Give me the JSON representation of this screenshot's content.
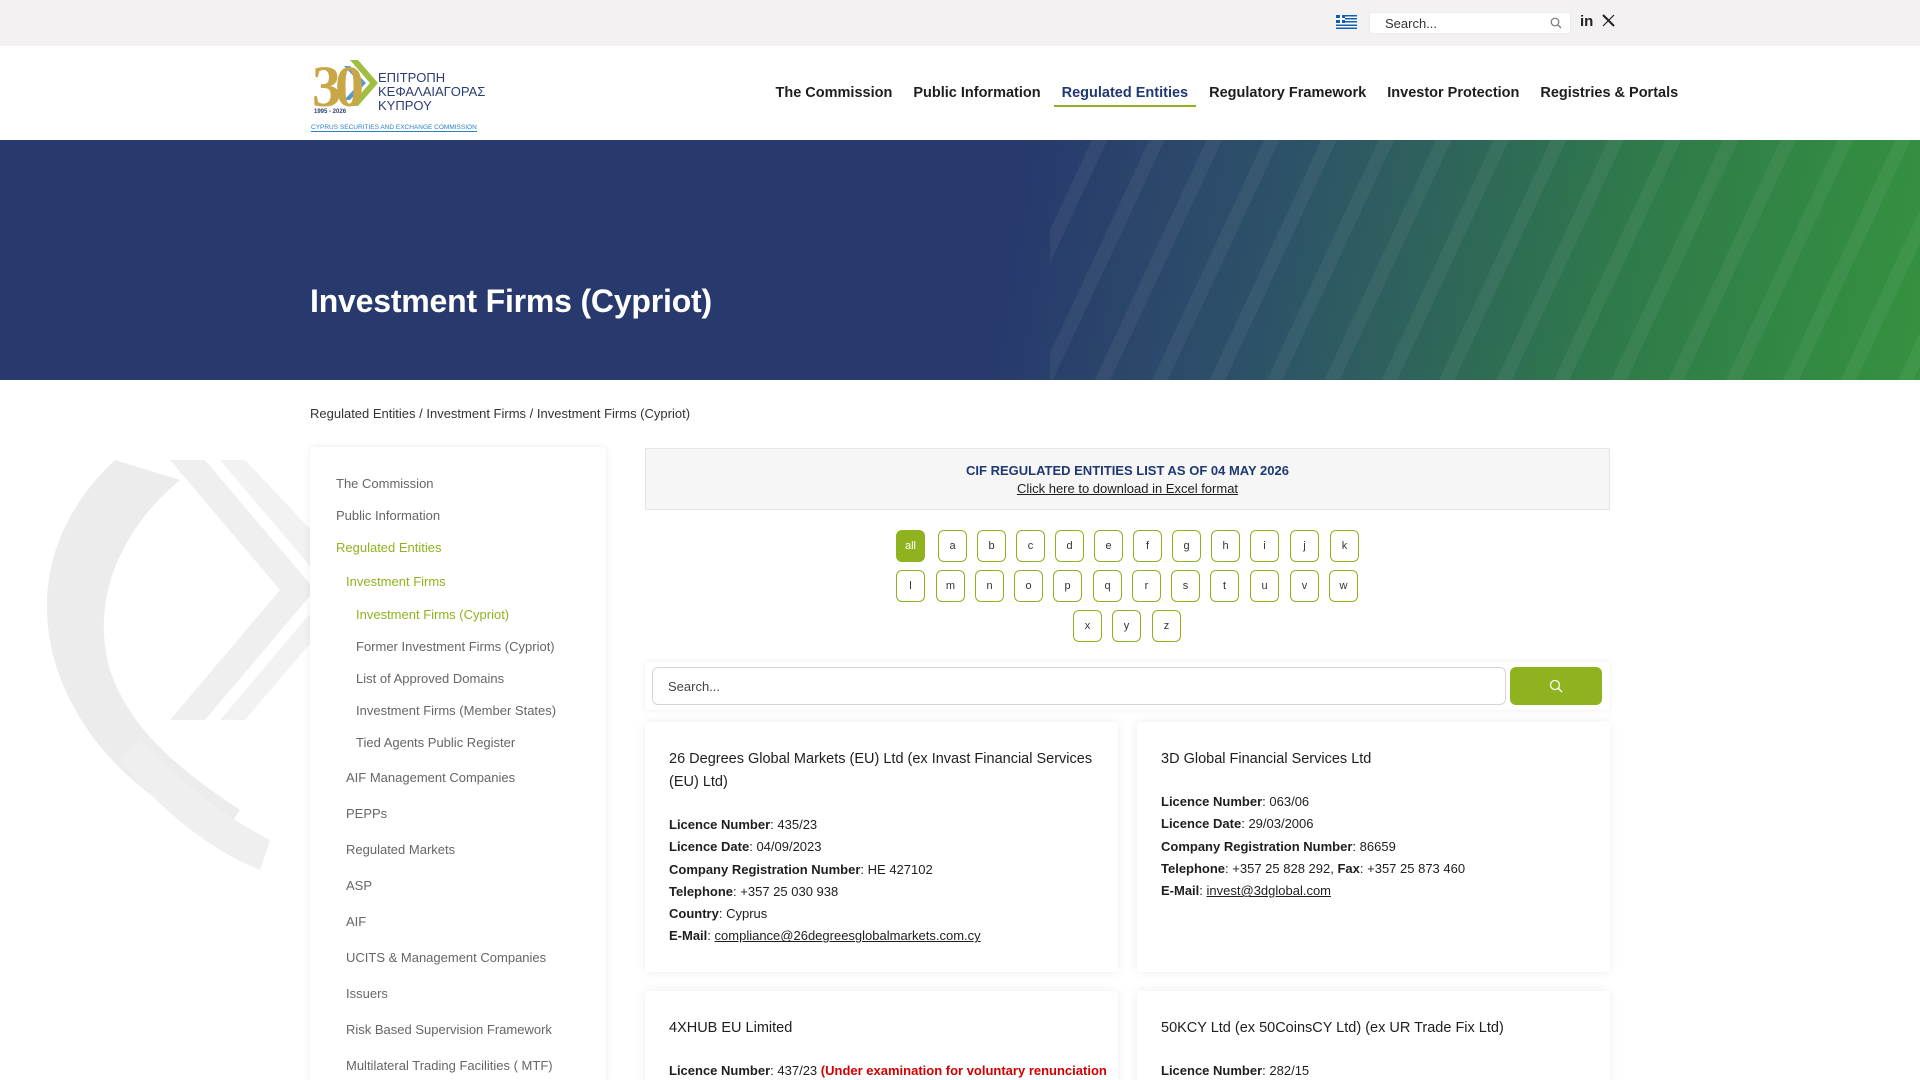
{
  "topbar": {
    "search_placeholder": "Search...",
    "linkedin_label": "in"
  },
  "logo": {
    "number": "30",
    "years": "1995 - 2026",
    "greek_line1": "ΕΠΙΤΡΟΠΗ",
    "greek_line2": "ΚΕΦΑΛΑΙΑΓΟΡΑΣ",
    "greek_line3": "ΚΥΠΡΟΥ",
    "english": "CYPRUS SECURITIES AND EXCHANGE COMMISSION"
  },
  "nav": {
    "items": [
      {
        "label": "The Commission"
      },
      {
        "label": "Public Information"
      },
      {
        "label": "Regulated Entities"
      },
      {
        "label": "Regulatory Framework"
      },
      {
        "label": "Investor Protection"
      },
      {
        "label": "Registries & Portals"
      }
    ]
  },
  "hero": {
    "title": "Investment Firms (Cypriot)"
  },
  "breadcrumb": {
    "items": [
      "Regulated Entities",
      "Investment Firms",
      "Investment Firms (Cypriot)"
    ],
    "separator": " / "
  },
  "sidebar": {
    "items": [
      {
        "label": "The Commission"
      },
      {
        "label": "Public Information"
      },
      {
        "label": "Regulated Entities"
      },
      {
        "label": "Investment Firms"
      },
      {
        "label": "Investment Firms (Cypriot)"
      },
      {
        "label": "Former Investment Firms (Cypriot)"
      },
      {
        "label": "List of Approved Domains"
      },
      {
        "label": "Investment Firms (Member States)"
      },
      {
        "label": "Tied Agents Public Register"
      },
      {
        "label": "AIF Management Companies"
      },
      {
        "label": "PEPPs"
      },
      {
        "label": "Regulated Markets"
      },
      {
        "label": "ASP"
      },
      {
        "label": "AIF"
      },
      {
        "label": "UCITS & Management Companies"
      },
      {
        "label": "Issuers"
      },
      {
        "label": "Risk Based Supervision Framework"
      },
      {
        "label": "Multilateral Trading Facilities ( MTF)"
      }
    ]
  },
  "banner": {
    "title": "CIF REGULATED ENTITIES LIST AS OF 04 MAY 2026",
    "download_link": "Click here to download in Excel format"
  },
  "letters": [
    "all",
    "a",
    "b",
    "c",
    "d",
    "e",
    "f",
    "g",
    "h",
    "i",
    "j",
    "k",
    "l",
    "m",
    "n",
    "o",
    "p",
    "q",
    "r",
    "s",
    "t",
    "u",
    "v",
    "w",
    "x",
    "y",
    "z"
  ],
  "search": {
    "placeholder": "Search..."
  },
  "cards": [
    {
      "name": "26 Degrees Global Markets (EU) Ltd (ex Invast Financial Services (EU) Ltd)",
      "licence_number_label": "Licence Number",
      "licence_number": "435/23",
      "licence_date_label": "Licence Date",
      "licence_date": "04/09/2023",
      "crn_label": "Company Registration Number",
      "crn": "HE 427102",
      "telephone_label": "Telephone",
      "telephone": "+357 25 030 938",
      "country_label": "Country",
      "country": "Cyprus",
      "email_label": "E-Mail",
      "email": "compliance@26degreesglobalmarkets.com.cy"
    },
    {
      "name": "3D Global Financial Services Ltd",
      "licence_number_label": "Licence Number",
      "licence_number": "063/06",
      "licence_date_label": "Licence Date",
      "licence_date": "29/03/2006",
      "crn_label": "Company Registration Number",
      "crn": "86659",
      "telephone_label": "Telephone",
      "telephone": "+357 25 828 292",
      "fax_label": "Fax",
      "fax": "+357 25 873 460",
      "email_label": "E-Mail",
      "email": "invest@3dglobal.com"
    },
    {
      "name": "4XHUB EU Limited",
      "licence_number_label": "Licence Number",
      "licence_number": "437/23",
      "status_note": "(Under examination for voluntary renunciation"
    },
    {
      "name": "50KCY Ltd (ex 50CoinsCY Ltd) (ex UR Trade Fix Ltd)",
      "licence_number_label": "Licence Number",
      "licence_number": "282/15"
    }
  ],
  "colors": {
    "brand_navy": "#28396d",
    "brand_green": "#8fb31e",
    "alert_red": "#d10000"
  }
}
